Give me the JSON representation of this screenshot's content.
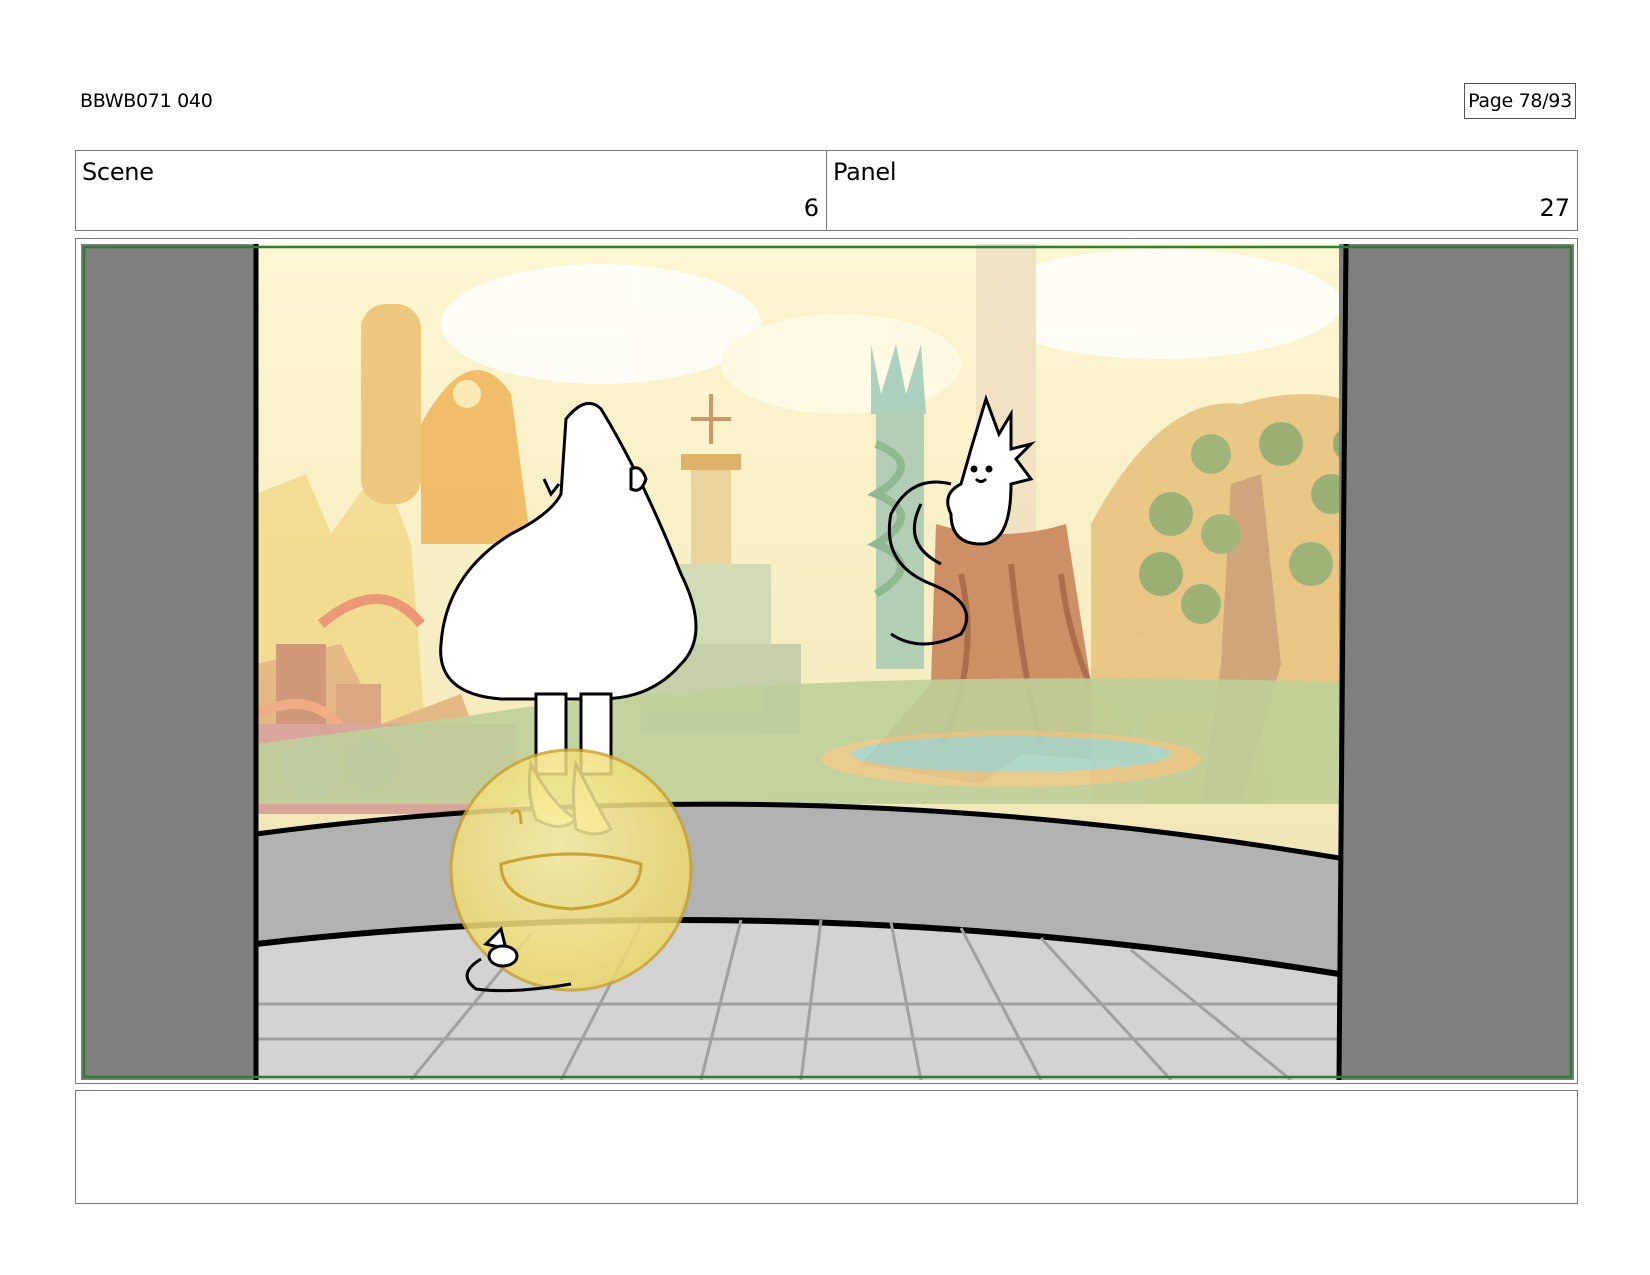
{
  "header": {
    "document_id": "BBWB071 040",
    "page_label": "Page 78/93"
  },
  "info": {
    "scene_label": "Scene",
    "scene_value": "6",
    "panel_label": "Panel",
    "panel_value": "27"
  },
  "notes": {
    "text": ""
  },
  "colors": {
    "safe_frame": "#2e7d32",
    "side_mat": "#7f7f7f",
    "bubble": "#f3e27a",
    "wall": "#b2b2b2",
    "floor": "#d3d3d3"
  }
}
